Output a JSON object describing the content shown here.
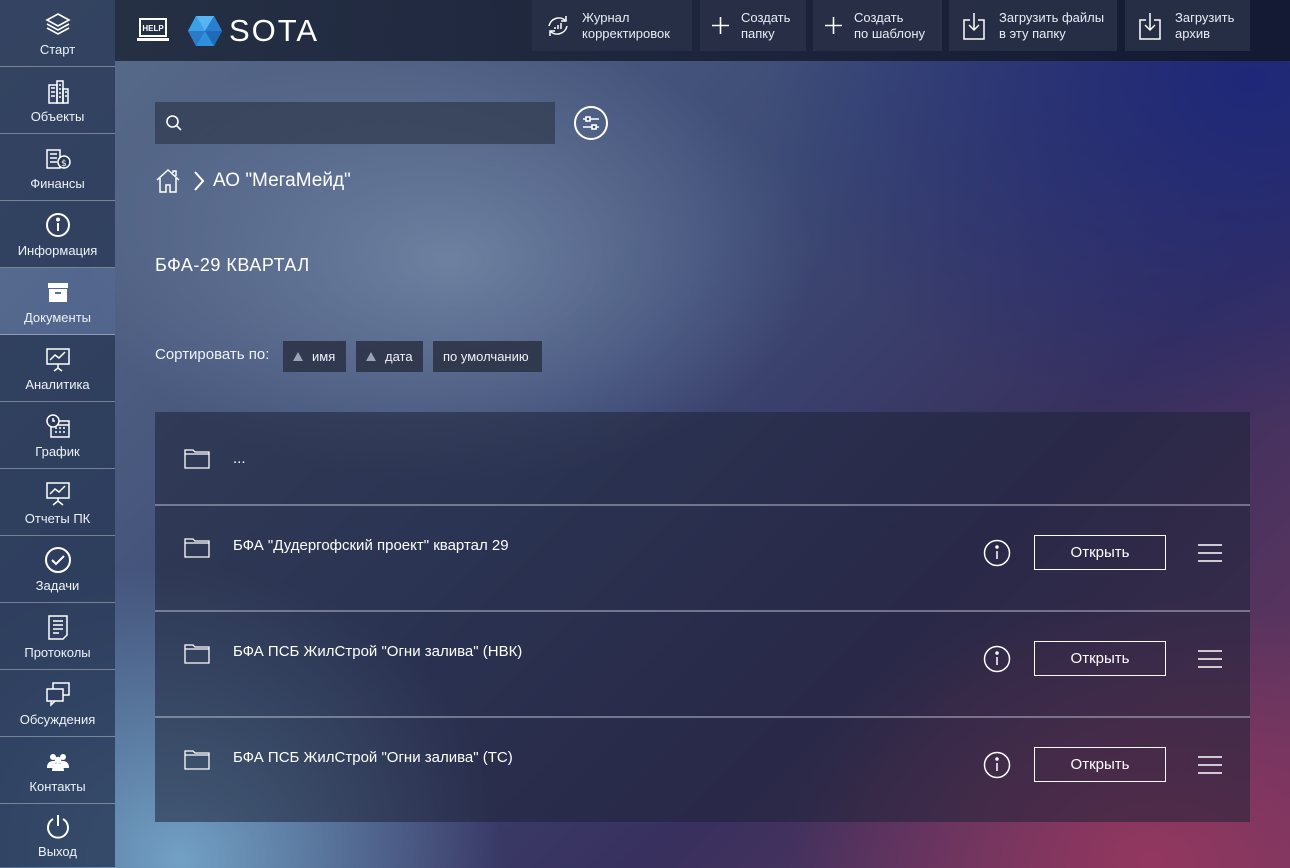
{
  "sidebar": {
    "items": [
      {
        "label": "Старт",
        "icon": "layers-icon"
      },
      {
        "label": "Объекты",
        "icon": "buildings-icon"
      },
      {
        "label": "Финансы",
        "icon": "finance-icon"
      },
      {
        "label": "Информация",
        "icon": "info-icon"
      },
      {
        "label": "Документы",
        "icon": "archive-box-icon",
        "active": true
      },
      {
        "label": "Аналитика",
        "icon": "presentation-chart-icon"
      },
      {
        "label": "График",
        "icon": "calendar-clock-icon"
      },
      {
        "label": "Отчеты ПК",
        "icon": "report-board-icon"
      },
      {
        "label": "Задачи",
        "icon": "check-circle-icon"
      },
      {
        "label": "Протоколы",
        "icon": "document-list-icon"
      },
      {
        "label": "Обсуждения",
        "icon": "chat-windows-icon"
      },
      {
        "label": "Контакты",
        "icon": "people-icon"
      },
      {
        "label": "Выход",
        "icon": "power-icon"
      }
    ]
  },
  "header": {
    "help_label": "HELP",
    "logo_text": "SOTA"
  },
  "search": {
    "value": "",
    "placeholder": ""
  },
  "breadcrumb": {
    "current": "АО \"МегаМейд\""
  },
  "page": {
    "title": "БФА-29 КВАРТАЛ"
  },
  "toolbar": {
    "journal": "Журнал\nкорректировок",
    "create_folder": "Создать\nпапку",
    "create_template": "Создать\nпо шаблону",
    "upload_files": "Загрузить файлы\nв эту папку",
    "upload_archive": "Загрузить\nархив"
  },
  "sort": {
    "label": "Сортировать по:",
    "options": [
      "имя",
      "дата",
      "по умолчанию"
    ]
  },
  "list": {
    "parent": "...",
    "open_label": "Открыть",
    "items": [
      {
        "name": "БФА \"Дудергофский проект\" квартал 29"
      },
      {
        "name": "БФА ПСБ ЖилСтрой \"Огни залива\" (НВК)"
      },
      {
        "name": "БФА ПСБ ЖилСтрой \"Огни залива\" (ТС)"
      }
    ]
  },
  "colors": {
    "sidebar_bg": "#28375a",
    "header_bg": "#1d2638",
    "logo_gem": "#3aa0e8",
    "button_bg": "#28304a"
  }
}
